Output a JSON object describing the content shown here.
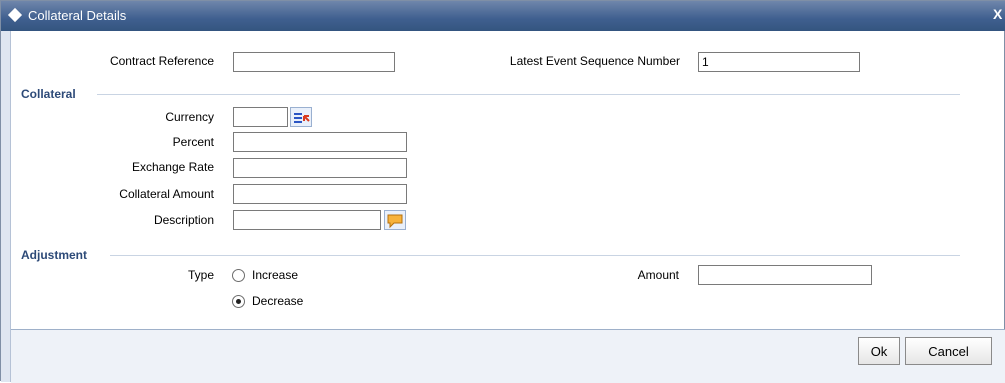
{
  "window": {
    "title": "Collateral Details",
    "close": "X"
  },
  "header": {
    "contract_reference": {
      "label": "Contract Reference",
      "value": ""
    },
    "latest_event_seq": {
      "label": "Latest Event Sequence Number",
      "value": "1"
    }
  },
  "collateral": {
    "section_title": "Collateral",
    "currency": {
      "label": "Currency",
      "value": "",
      "icon": "list-of-values-icon"
    },
    "percent": {
      "label": "Percent",
      "value": ""
    },
    "exchange_rate": {
      "label": "Exchange Rate",
      "value": ""
    },
    "collateral_amount": {
      "label": "Collateral Amount",
      "value": ""
    },
    "description": {
      "label": "Description",
      "value": "",
      "icon": "comment-icon"
    }
  },
  "adjustment": {
    "section_title": "Adjustment",
    "type_label": "Type",
    "options": [
      {
        "label": "Increase",
        "selected": false
      },
      {
        "label": "Decrease",
        "selected": true
      }
    ],
    "amount": {
      "label": "Amount",
      "value": ""
    }
  },
  "footer": {
    "ok": "Ok",
    "cancel": "Cancel"
  },
  "colors": {
    "title_bar": "#3f5f8f",
    "section_text": "#2d4a78"
  }
}
